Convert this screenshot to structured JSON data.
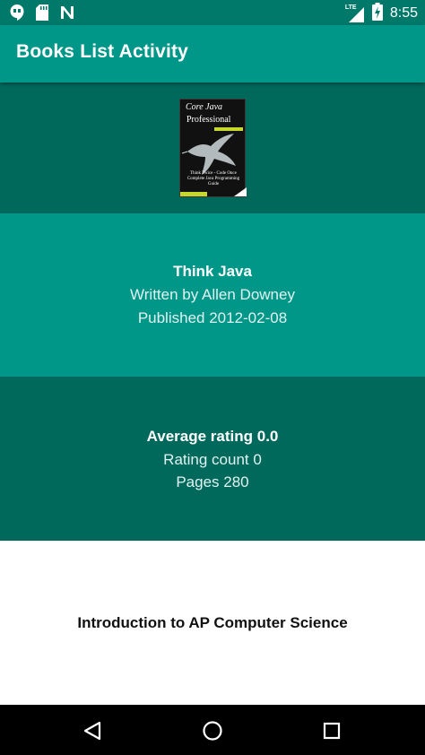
{
  "status_bar": {
    "time": "8:55",
    "network": "LTE",
    "icons": [
      "hangouts-icon",
      "sd-card-icon",
      "n-notification-icon",
      "lte-signal-icon",
      "battery-charging-icon"
    ]
  },
  "app_bar": {
    "title": "Books List Activity"
  },
  "book": {
    "cover_title": "Core Java",
    "cover_subtitle": "Professional",
    "cover_tagline": "Think Twice - Code Once",
    "cover_tagline2": "Complete Java Programming Guide",
    "title": "Think Java",
    "author": "Written by Allen Downey",
    "published": "Published 2012-02-08"
  },
  "ratings": {
    "average": "Average rating 0.0",
    "count": "Rating count 0",
    "pages": "Pages 280"
  },
  "next_item": {
    "title": "Introduction to AP Computer Science"
  },
  "colors": {
    "status_bar": "#00796b",
    "app_bar": "#009688",
    "dark_section": "#00695c",
    "light_section": "#009688"
  }
}
